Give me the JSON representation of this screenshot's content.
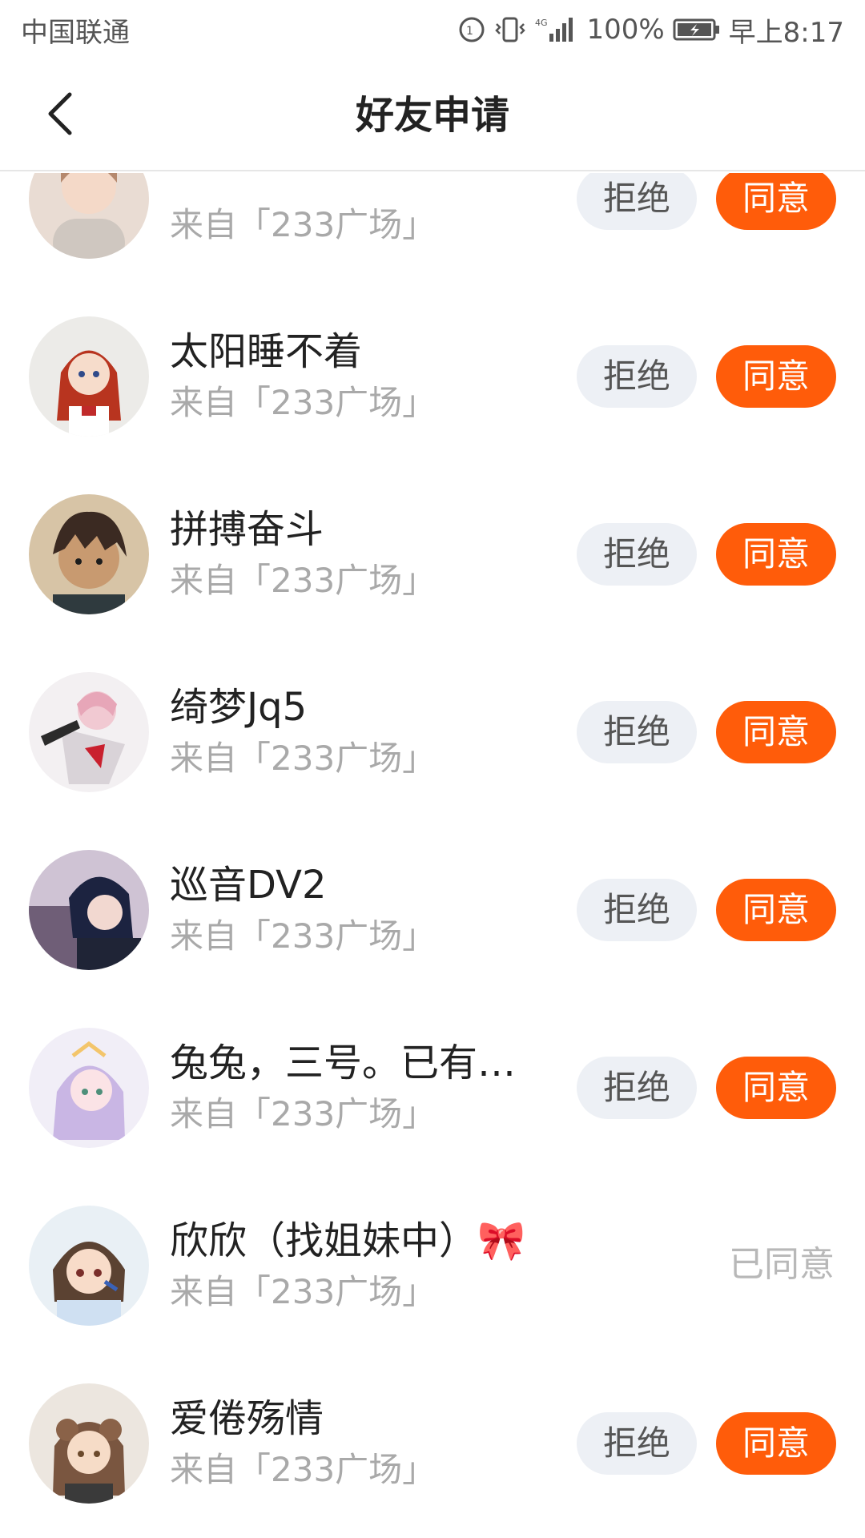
{
  "status_bar": {
    "carrier": "中国联通",
    "battery": "100%",
    "time": "早上8:17"
  },
  "header": {
    "title": "好友申请"
  },
  "buttons": {
    "reject": "拒绝",
    "accept": "同意",
    "accepted": "已同意"
  },
  "requests": [
    {
      "name": "",
      "source": "来自「233广场」",
      "status": "pending"
    },
    {
      "name": "太阳睡不着",
      "source": "来自「233广场」",
      "status": "pending"
    },
    {
      "name": "拼搏奋斗",
      "source": "来自「233广场」",
      "status": "pending"
    },
    {
      "name": "绮梦Jq5",
      "source": "来自「233广场」",
      "status": "pending"
    },
    {
      "name": "巡音DV2",
      "source": "来自「233广场」",
      "status": "pending"
    },
    {
      "name": "兔兔，三号。已有…",
      "source": "来自「233广场」",
      "status": "pending"
    },
    {
      "name": "欣欣（找姐妹中）🎀",
      "source": "来自「233广场」",
      "status": "accepted"
    },
    {
      "name": "爱倦殇情",
      "source": "来自「233广场」",
      "status": "pending"
    }
  ],
  "colors": {
    "accent": "#ff5c0a",
    "reject_bg": "#edf0f5",
    "secondary_text": "#a9a9a9"
  }
}
